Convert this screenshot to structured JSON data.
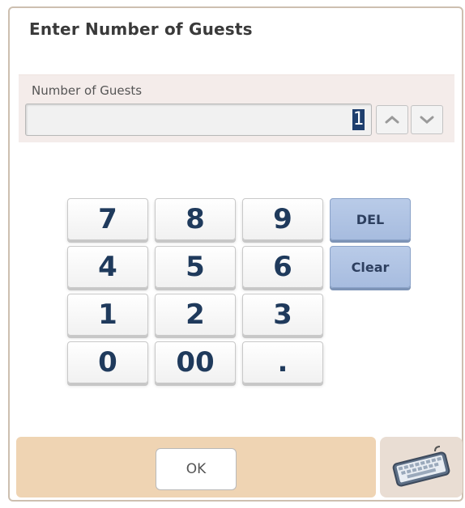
{
  "dialog": {
    "title": "Enter Number of Guests"
  },
  "field": {
    "label": "Number of Guests",
    "value": "1",
    "spin_up_icon": "chevron-up-icon",
    "spin_down_icon": "chevron-down-icon"
  },
  "keypad": {
    "keys": [
      "7",
      "8",
      "9",
      "4",
      "5",
      "6",
      "1",
      "2",
      "3",
      "0",
      "00",
      "."
    ],
    "del_label": "DEL",
    "clear_label": "Clear"
  },
  "footer": {
    "ok_label": "OK",
    "keyboard_icon": "keyboard-icon"
  },
  "colors": {
    "title_text": "#3a3a3a",
    "digit_text": "#1f3a5c",
    "action_key_bg": "#b0c3e3",
    "footer_bg": "#efd4b3",
    "field_panel_bg": "#f4ecea"
  }
}
